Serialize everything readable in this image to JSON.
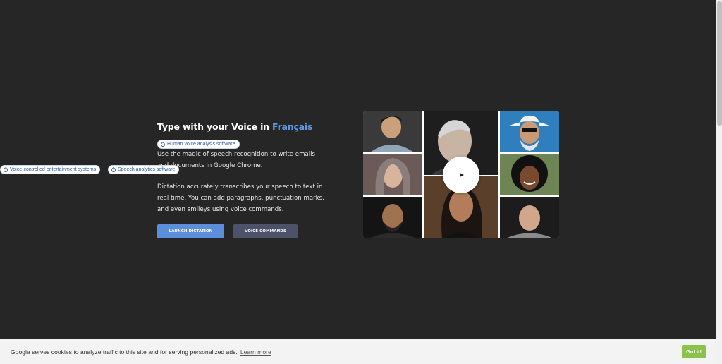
{
  "hero": {
    "title_prefix": "Type with your Voice in ",
    "title_language": "Français",
    "paragraph1": "Use the magic of speech recognition to write emails and documents in Google Chrome.",
    "paragraph2": "Dictation accurately transcribes your speech to text in real time. You can add paragraphs, punctuation marks, and even smileys using voice commands."
  },
  "buttons": {
    "launch_label": "LAUNCH DICTATION",
    "voice_label": "VOICE COMMANDS"
  },
  "tags": [
    {
      "label": "Human voice analysis software"
    },
    {
      "label": "Voice-controlled entertainment systems"
    },
    {
      "label": "Speech analytics software"
    }
  ],
  "video": {
    "play_icon": "play-icon",
    "tiles": [
      "portrait-young-man",
      "portrait-older-man",
      "portrait-man-cowboy-hat",
      "portrait-woman-headscarf",
      "portrait-woman-smiling",
      "portrait-bearded-man",
      "portrait-woman-dark-hair",
      "portrait-man-short-hair"
    ]
  },
  "cookie_banner": {
    "text": "Google serves cookies to analyze traffic to this site and for serving personalized ads.",
    "learn_more": "Learn more",
    "got_it": "Got it!"
  },
  "colors": {
    "background": "#262626",
    "accent": "#5c9ae6",
    "launch_button": "#5b8fdb",
    "voice_button": "#4b5269",
    "got_it_button": "#8bc34a"
  }
}
